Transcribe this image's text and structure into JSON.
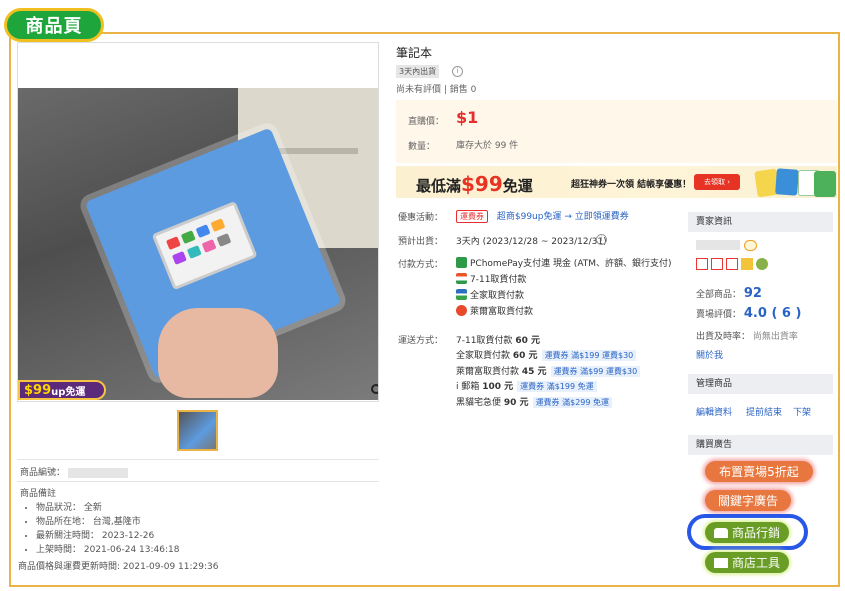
{
  "page_tag": "商品頁",
  "product": {
    "title": "筆記本",
    "ship_badge": "3天內出貨",
    "rating_text": "尚未有評價",
    "sales_label": "銷售",
    "sales_count": "0",
    "price_label": "直購價：",
    "price": "$1",
    "qty_label": "數量：",
    "stock_text": "庫存大於 99 件"
  },
  "image_badge": {
    "prefix": "$99",
    "suffix": "up免運"
  },
  "banner": {
    "big_prefix": "最低滿",
    "big_amount": "$99",
    "big_suffix": "免運",
    "sub": "超狂神券一次領 結帳享優惠！",
    "go": "去領取 ›"
  },
  "details": {
    "promo_label": "優惠活動：",
    "promo_tag": "運費券",
    "promo_link": "超商$99up免運 → 立即領運費券",
    "eta_label": "預計出貨：",
    "eta_value": "3天內 (2023/12/28 ~ 2023/12/31)",
    "pay_label": "付款方式：",
    "pay_methods": [
      "PChomePay支付連 現金 (ATM、許額、銀行支付)",
      "7-11取貨付款",
      "全家取貨付款",
      "萊爾富取貨付款"
    ],
    "ship_label": "運送方式：",
    "shipping": [
      {
        "name": "7-11取貨付款",
        "price": "60 元",
        "tag": ""
      },
      {
        "name": "全家取貨付款",
        "price": "60 元",
        "tag": "運費券 滿$199 運費$30"
      },
      {
        "name": "萊爾富取貨付款",
        "price": "45 元",
        "tag": "運費券 滿$99 運費$30"
      },
      {
        "name": "i 郵箱",
        "price": "100 元",
        "tag": "運費券 滿$199 免運"
      },
      {
        "name": "黑貓宅急便",
        "price": "90 元",
        "tag": "運費券 滿$299 免運"
      }
    ]
  },
  "left_info": {
    "item_no_label": "商品編號：",
    "notes_title": "商品備註",
    "notes": [
      "物品狀況： 全新",
      "物品所在地： 台灣,基隆市",
      "最新關注時間： 2023-12-26",
      "上架時間： 2021-06-24 13:46:18"
    ],
    "updated": "商品價格與運費更新時間: 2021-09-09 11:29:36"
  },
  "sidebar": {
    "seller_header": "賣家資訊",
    "total_items_label": "全部商品：",
    "total_items": "92",
    "rating_label": "賣場評價：",
    "rating": "4.0 ( 6 )",
    "ship_rate_label": "出貨及時率：",
    "ship_rate_value": "尚無出貨率",
    "about": "關於我",
    "manage_header": "管理商品",
    "manage_links": [
      "編輯資料",
      "提前結束",
      "下架"
    ],
    "ads_header": "購買廣告",
    "buttons": [
      "布置賣場5折起",
      "關鍵字廣告",
      "商品行銷",
      "商店工具"
    ]
  },
  "colors": {
    "frame": "#e9b347",
    "tag_green": "#1ea63c",
    "price_red": "#e62e2e",
    "ring_blue": "#2857e8"
  }
}
